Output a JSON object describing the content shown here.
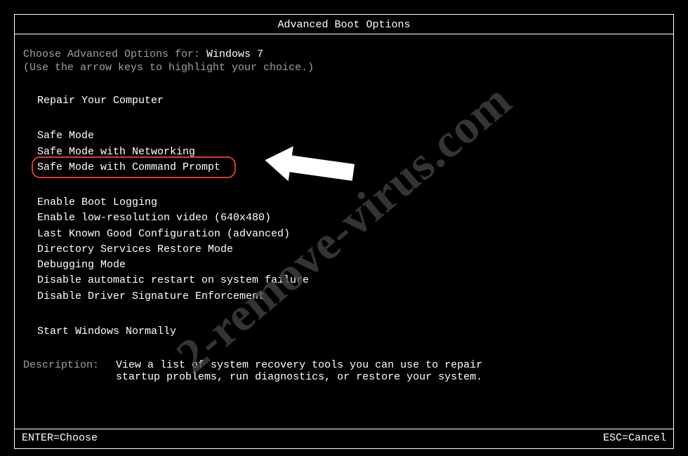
{
  "title": "Advanced Boot Options",
  "prompt_prefix": "Choose Advanced Options for: ",
  "os_name": "Windows 7",
  "hint": "(Use the arrow keys to highlight your choice.)",
  "groups": {
    "g1": [
      "Repair Your Computer"
    ],
    "g2": [
      "Safe Mode",
      "Safe Mode with Networking",
      "Safe Mode with Command Prompt"
    ],
    "g3": [
      "Enable Boot Logging",
      "Enable low-resolution video (640x480)",
      "Last Known Good Configuration (advanced)",
      "Directory Services Restore Mode",
      "Debugging Mode",
      "Disable automatic restart on system failure",
      "Disable Driver Signature Enforcement"
    ],
    "g4": [
      "Start Windows Normally"
    ]
  },
  "description_label": "Description:",
  "description_text": "View a list of system recovery tools you can use to repair startup problems, run diagnostics, or restore your system.",
  "footer_left": "ENTER=Choose",
  "footer_right": "ESC=Cancel",
  "watermark": "2-remove-virus.com"
}
